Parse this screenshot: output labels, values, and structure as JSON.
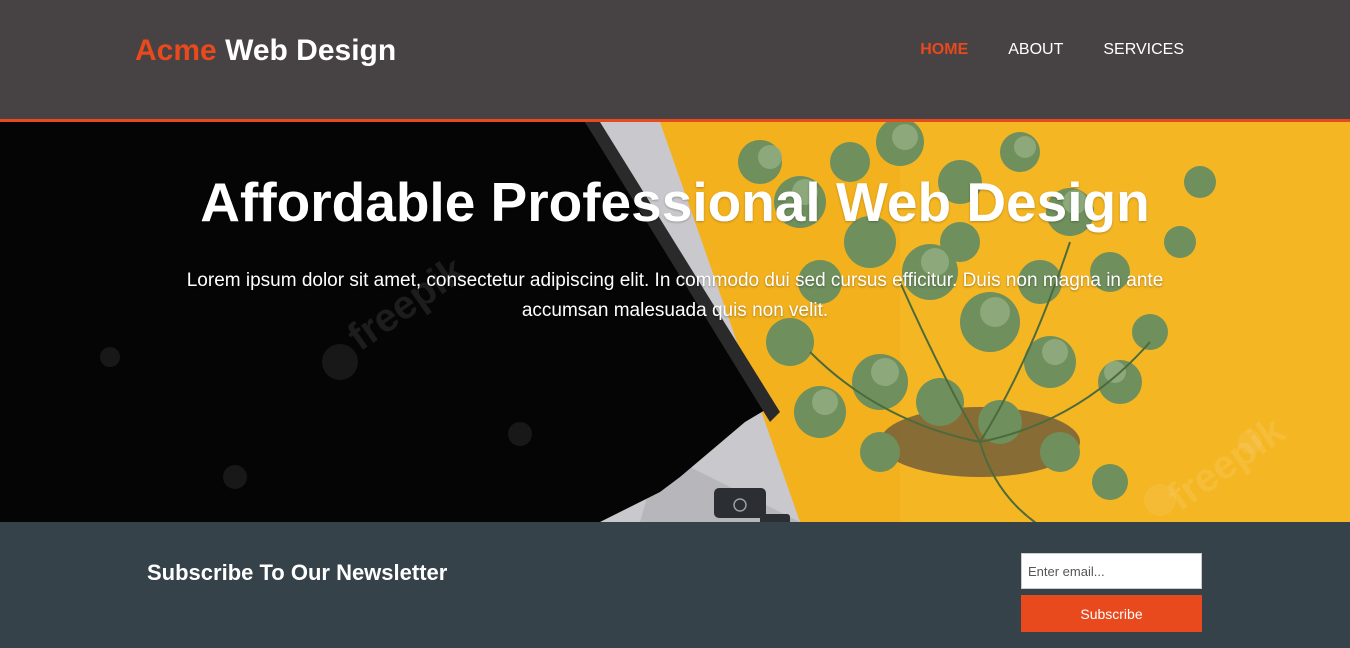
{
  "brand": {
    "accent_text": "Acme",
    "rest_text": "Web Design"
  },
  "nav": {
    "items": [
      {
        "label": "HOME",
        "active": true
      },
      {
        "label": "ABOUT",
        "active": false
      },
      {
        "label": "SERVICES",
        "active": false
      }
    ]
  },
  "hero": {
    "title": "Affordable Professional Web Design",
    "text": "Lorem ipsum dolor sit amet, consectetur adipiscing elit. In commodo dui sed cursus efficitur. Duis non magna in ante accumsan malesuada quis non velit.",
    "watermark": "freepik"
  },
  "newsletter": {
    "title": "Subscribe To Our Newsletter",
    "email_placeholder": "Enter email...",
    "email_value": "",
    "button_label": "Subscribe"
  },
  "colors": {
    "accent": "#e8491d",
    "header_bg": "#474243",
    "newsletter_bg": "#35424a",
    "hero_yellow": "#f4b11f"
  }
}
